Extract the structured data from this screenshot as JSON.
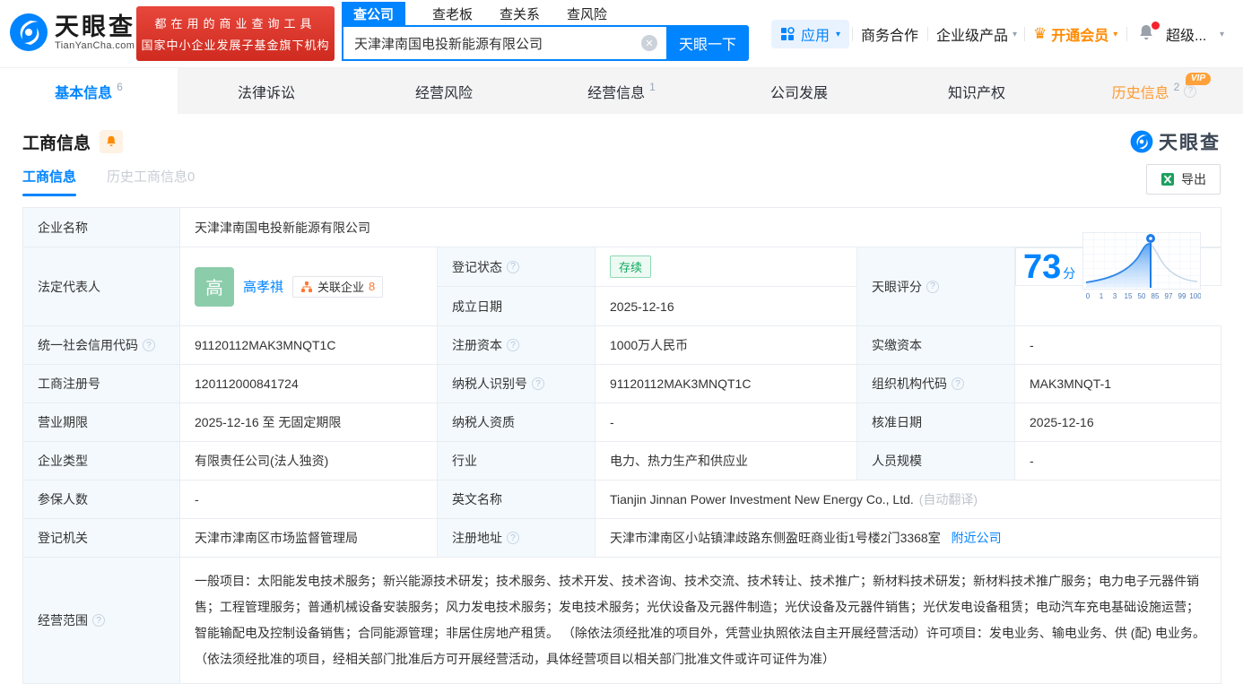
{
  "brand": {
    "name": "天眼查",
    "site": "TianYanCha.com",
    "promo_line1": "都在用的商业查询工具",
    "promo_line2": "国家中小企业发展子基金旗下机构"
  },
  "search": {
    "tabs": [
      "查公司",
      "查老板",
      "查关系",
      "查风险"
    ],
    "value": "天津津南国电投新能源有限公司",
    "button_label": "天眼一下"
  },
  "topnav": {
    "apps_label": "应用",
    "business_coop": "商务合作",
    "enterprise_products": "企业级产品",
    "vip_upgrade": "开通会员",
    "super_vip": "超级..."
  },
  "nav_tabs": [
    {
      "label": "基本信息",
      "count": "6"
    },
    {
      "label": "法律诉讼",
      "count": ""
    },
    {
      "label": "经营风险",
      "count": ""
    },
    {
      "label": "经营信息",
      "count": "1"
    },
    {
      "label": "公司发展",
      "count": ""
    },
    {
      "label": "知识产权",
      "count": ""
    },
    {
      "label": "历史信息",
      "count": "2",
      "vip": "VIP"
    }
  ],
  "section": {
    "title": "工商信息",
    "watermark": "天眼查",
    "subtab_active": "工商信息",
    "subtab_history": "历史工商信息0",
    "export_label": "导出"
  },
  "legal_rep": {
    "avatar_char": "高",
    "name": "高孝祺",
    "related_label": "关联企业",
    "related_count": "8"
  },
  "tianyan_score": {
    "label": "天眼评分",
    "value": "73",
    "unit": "分",
    "axis_ticks": [
      "0",
      "1",
      "3",
      "15",
      "50",
      "85",
      "97",
      "99",
      "100"
    ]
  },
  "info": {
    "company_name": {
      "label": "企业名称",
      "value": "天津津南国电投新能源有限公司"
    },
    "legal_rep_label": "法定代表人",
    "reg_status": {
      "label": "登记状态",
      "value": "存续"
    },
    "established": {
      "label": "成立日期",
      "value": "2025-12-16"
    },
    "uscc": {
      "label": "统一社会信用代码",
      "value": "91120112MAK3MNQT1C"
    },
    "reg_capital": {
      "label": "注册资本",
      "value": "1000万人民币"
    },
    "paid_capital": {
      "label": "实缴资本",
      "value": "-"
    },
    "reg_number": {
      "label": "工商注册号",
      "value": "120112000841724"
    },
    "taxpayer_id": {
      "label": "纳税人识别号",
      "value": "91120112MAK3MNQT1C"
    },
    "org_code": {
      "label": "组织机构代码",
      "value": "MAK3MNQT-1"
    },
    "business_term": {
      "label": "营业期限",
      "value": "2025-12-16 至 无固定期限"
    },
    "taxpayer_quality": {
      "label": "纳税人资质",
      "value": "-"
    },
    "approval_date": {
      "label": "核准日期",
      "value": "2025-12-16"
    },
    "company_type": {
      "label": "企业类型",
      "value": "有限责任公司(法人独资)"
    },
    "industry": {
      "label": "行业",
      "value": "电力、热力生产和供应业"
    },
    "staff_size": {
      "label": "人员规模",
      "value": "-"
    },
    "insured_count": {
      "label": "参保人数",
      "value": "-"
    },
    "english_name": {
      "label": "英文名称",
      "value": "Tianjin Jinnan Power Investment New Energy Co., Ltd.",
      "note": "(自动翻译)"
    },
    "reg_authority": {
      "label": "登记机关",
      "value": "天津市津南区市场监督管理局"
    },
    "reg_address": {
      "label": "注册地址",
      "value": "天津市津南区小站镇津歧路东侧盈旺商业街1号楼2门3368室",
      "link": "附近公司"
    },
    "business_scope": {
      "label": "经营范围",
      "value": "一般项目：太阳能发电技术服务；新兴能源技术研发；技术服务、技术开发、技术咨询、技术交流、技术转让、技术推广；新材料技术研发；新材料技术推广服务；电力电子元器件销售；工程管理服务；普通机械设备安装服务；风力发电技术服务；发电技术服务；光伏设备及元器件制造；光伏设备及元器件销售；光伏发电设备租赁；电动汽车充电基础设施运营；智能输配电及控制设备销售；合同能源管理；非居住房地产租赁。 （除依法须经批准的项目外，凭营业执照依法自主开展经营活动）许可项目：发电业务、输电业务、供 (配) 电业务。 （依法须经批准的项目，经相关部门批准后方可开展经营活动，具体经营项目以相关部门批准文件或许可证件为准）"
    }
  },
  "colors": {
    "accent_blue": "#0084ff",
    "vip_orange": "#ff8a00",
    "promo_red": "#d9332a",
    "status_green": "#0fa85e",
    "avatar_green": "#8bccaa"
  }
}
